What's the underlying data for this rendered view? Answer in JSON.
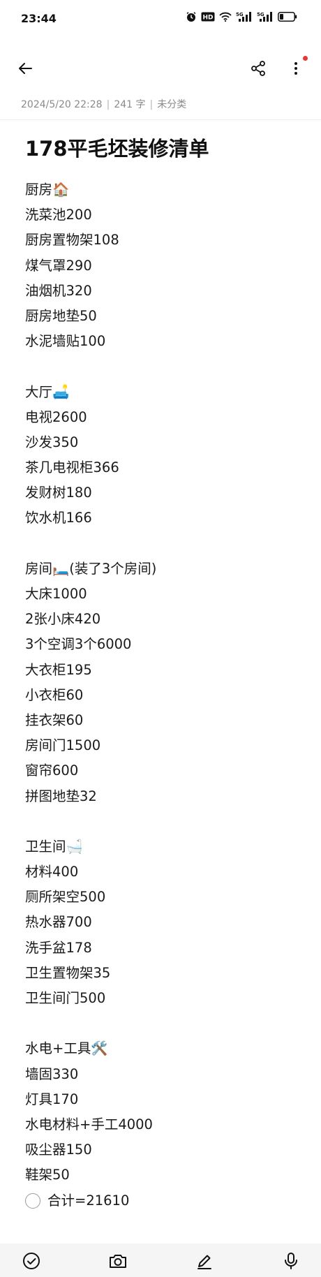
{
  "status": {
    "time": "23:44",
    "icons": [
      "alarm-icon",
      "hd-icon",
      "wifi-icon",
      "signal-5g-icon",
      "signal-5g-icon",
      "battery-icon"
    ],
    "hd_label": "HD",
    "net1": "5G",
    "net2": "5G"
  },
  "toolbar": {
    "back_icon": "arrow-left-icon",
    "share_icon": "share-icon",
    "more_icon": "more-vertical-icon",
    "notification_dot_color": "#e53935"
  },
  "meta": {
    "datetime": "2024/5/20 22:28",
    "separator": "|",
    "word_count": "241 字",
    "category": "未分类"
  },
  "note": {
    "title": "178平毛坯装修清单",
    "lines": [
      "厨房🏠",
      "洗菜池200",
      "厨房置物架108",
      "煤气罩290",
      "油烟机320",
      "厨房地垫50",
      "水泥墙贴100",
      "",
      "大厅🛋️",
      "电视2600",
      "沙发350",
      "茶几电视柜366",
      "发财树180",
      "饮水机166",
      "",
      "房间🛏️(装了3个房间)",
      "大床1000",
      "2张小床420",
      "3个空调3个6000",
      "大衣柜195",
      "小衣柜60",
      "挂衣架60",
      "房间门1500",
      "窗帘600",
      "拼图地垫32",
      "",
      "卫生间🛁",
      "材料400",
      "厕所架空500",
      "热水器700",
      "洗手盆178",
      "卫生置物架35",
      "卫生间门500",
      "",
      "水电+工具🛠️",
      "墙固330",
      "灯具170",
      "水电材料+手工4000",
      "吸尘器150",
      "鞋架50"
    ],
    "todo": {
      "text": "合计=21610",
      "checked": false
    }
  },
  "bottom_bar": {
    "buttons": [
      "checkbox-icon",
      "camera-icon",
      "pen-icon",
      "microphone-icon"
    ]
  }
}
